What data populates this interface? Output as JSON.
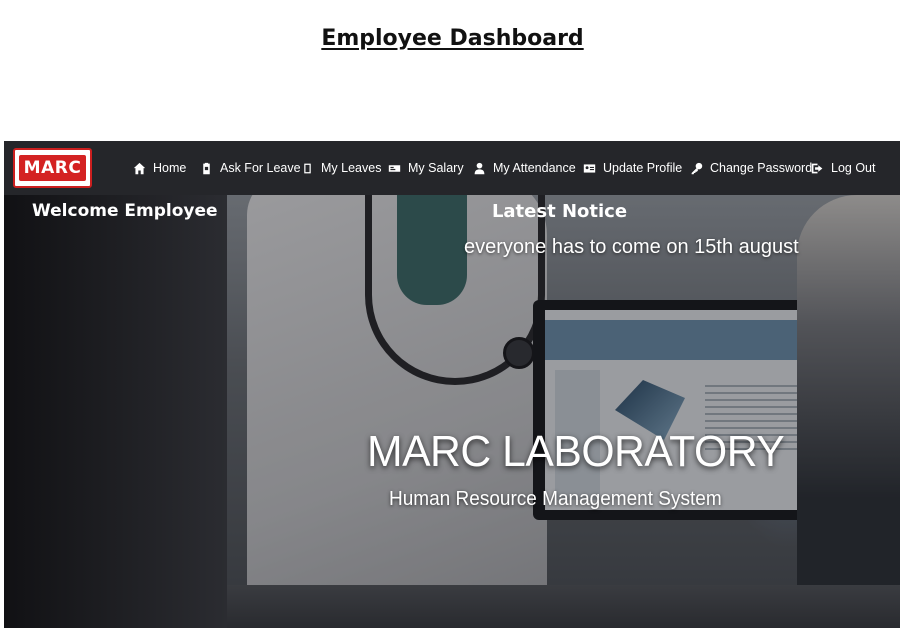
{
  "document": {
    "title": "Employee Dashboard"
  },
  "navbar": {
    "logo_text": "MARC",
    "items": [
      {
        "label": "Home",
        "icon": "home-icon"
      },
      {
        "label": "Ask For Leave",
        "icon": "clipboard-icon"
      },
      {
        "label": "My Leaves",
        "icon": "placeholder-icon"
      },
      {
        "label": "My Salary",
        "icon": "money-icon"
      },
      {
        "label": "My Attendance",
        "icon": "user-icon"
      },
      {
        "label": "Update Profile",
        "icon": "id-card-icon"
      },
      {
        "label": "Change Password",
        "icon": "key-icon"
      },
      {
        "label": "Log Out",
        "icon": "logout-icon"
      }
    ]
  },
  "sidebar": {
    "welcome": "Welcome Employee"
  },
  "notice": {
    "title": "Latest Notice",
    "text": "everyone has to come on 15th august"
  },
  "hero": {
    "brand": "MARC LABORATORY",
    "subtitle": "Human Resource Management System"
  },
  "colors": {
    "logo_red": "#d42222",
    "navbar_bg": "#25262a",
    "text": "#ffffff"
  }
}
